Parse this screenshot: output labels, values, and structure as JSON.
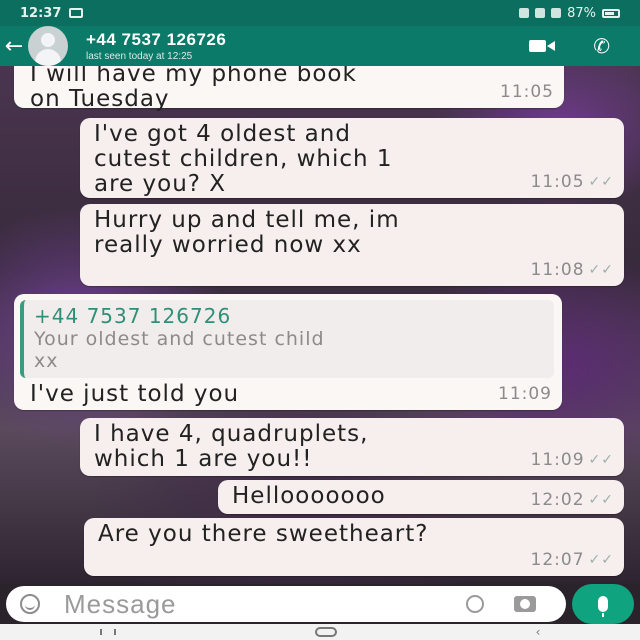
{
  "status_bar": {
    "time": "12:37",
    "battery": "87%"
  },
  "header": {
    "contact_name": "+44 7537 126726",
    "last_seen": "last seen today at 12:25"
  },
  "messages": [
    {
      "id": "m0",
      "type": "received",
      "text": "I will have my phone book\non Tuesday",
      "time": "11:05"
    },
    {
      "id": "m1",
      "type": "sent",
      "text": "I've got 4 oldest and\ncutest children, which 1\nare you? X",
      "time": "11:05"
    },
    {
      "id": "m2",
      "type": "sent",
      "text": "Hurry up and tell me, im\nreally worried now xx",
      "time": "11:08"
    },
    {
      "id": "m3",
      "type": "received",
      "quote_name": "+44 7537 126726",
      "quote_text": "Your oldest and cutest child\nxx",
      "text": "I've just told you",
      "time": "11:09"
    },
    {
      "id": "m4",
      "type": "sent",
      "text": "I have 4, quadruplets,\nwhich 1 are you!!",
      "time": "11:09"
    },
    {
      "id": "m5",
      "type": "sent",
      "text": "Hellooooooo",
      "time": "12:02"
    },
    {
      "id": "m6",
      "type": "sent",
      "text": "Are you there sweetheart?",
      "time": "12:07"
    }
  ],
  "composer": {
    "placeholder": "Message"
  },
  "icons": {
    "back": "arrow-left-icon",
    "video": "video-call-icon",
    "call": "phone-icon",
    "emoji": "emoji-icon",
    "attach": "paperclip-icon",
    "camera": "camera-icon",
    "mic": "microphone-icon"
  },
  "colors": {
    "header": "#0b7a68",
    "status_bar": "#0b6e5f",
    "mic_button": "#0fa37f",
    "bubble": "#fbf7f4"
  }
}
